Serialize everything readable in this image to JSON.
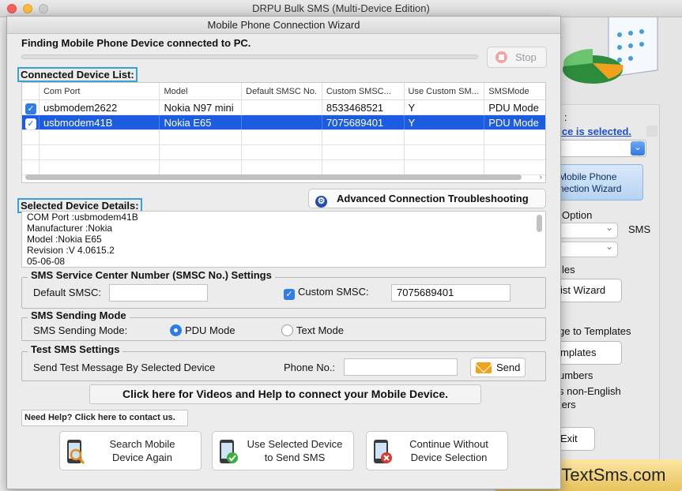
{
  "app": {
    "title": "DRPU Bulk SMS (Multi-Device Edition)",
    "watermark": "MobileTextSms.com"
  },
  "background": {
    "partial_texts": {
      "device_label": "e :",
      "device_selected_link": "vice is selected.",
      "wizard_button": [
        "Mobile Phone",
        "nection  Wizard"
      ],
      "option_label": "Option",
      "sms_label": "SMS",
      "les_label": "les",
      "list_wizard_button": "ist Wizard",
      "templates_label": "ge to Templates",
      "templates_button": "mplates",
      "numbers_label": "umbers",
      "non_english_label": "s non-English",
      "ters_label": "ters",
      "exit_button": "Exit"
    }
  },
  "dialog": {
    "title": "Mobile Phone Connection Wizard",
    "status_text": "Finding Mobile Phone Device connected to PC.",
    "progress": 0,
    "stop_label": "Stop",
    "connected_list_label": "Connected Device List:",
    "table": {
      "columns": [
        "Com Port",
        "Model",
        "Default SMSC No.",
        "Custom SMSC...",
        "Use Custom SM...",
        "SMSMode"
      ],
      "rows": [
        {
          "checked": true,
          "selected": false,
          "cells": [
            "usbmodem2622",
            "Nokia N97 mini",
            "",
            "8533468521",
            "Y",
            "PDU Mode"
          ]
        },
        {
          "checked": true,
          "selected": true,
          "cells": [
            "usbmodem41B",
            "Nokia E65",
            "",
            "7075689401",
            "Y",
            "PDU Mode"
          ]
        }
      ]
    },
    "advanced_button": "Advanced Connection Troubleshooting",
    "selected_details_label": "Selected Device Details:",
    "details_lines": [
      "COM Port :usbmodem41B",
      "Manufacturer :Nokia",
      "Model :Nokia E65",
      "Revision :V 4.0615.2",
      "05-06-08"
    ],
    "smsc": {
      "title": "SMS Service Center Number (SMSC No.) Settings",
      "default_label": "Default SMSC:",
      "default_value": "",
      "custom_label": "Custom SMSC:",
      "custom_checked": true,
      "custom_value": "7075689401"
    },
    "sending_mode": {
      "title": "SMS Sending Mode",
      "label": "SMS Sending Mode:",
      "options": [
        "PDU Mode",
        "Text Mode"
      ],
      "selected": "PDU Mode"
    },
    "test_sms": {
      "title": "Test SMS Settings",
      "label": "Send Test Message By Selected Device",
      "phone_label": "Phone No.:",
      "phone_value": "",
      "send_label": "Send"
    },
    "help_bar": "Click here for Videos and Help to connect your Mobile Device.",
    "contact_link": "Need Help? Click here to contact us.",
    "buttons": {
      "search_again": [
        "Search Mobile",
        "Device Again"
      ],
      "use_selected": [
        "Use Selected Device",
        "to Send SMS"
      ],
      "continue_without": [
        "Continue Without",
        "Device Selection"
      ]
    }
  }
}
